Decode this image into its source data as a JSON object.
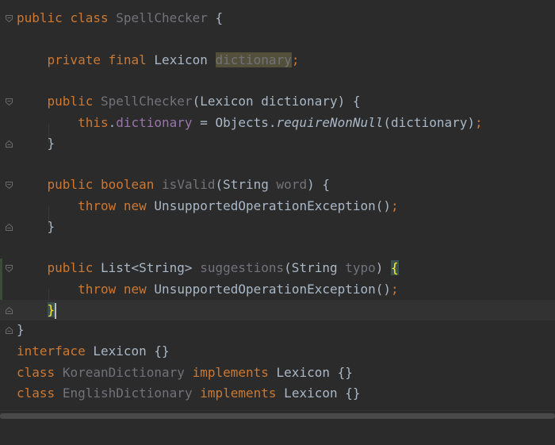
{
  "editor": {
    "lines": {
      "l1": {
        "kw1": "public",
        "kw2": "class",
        "name": "SpellChecker",
        "rest": " {"
      },
      "l3": {
        "kw1": "private",
        "kw2": "final",
        "type": "Lexicon",
        "field": "dictionary",
        "semi": ";"
      },
      "l5": {
        "kw": "public",
        "name": "SpellChecker",
        "rest": "(Lexicon dictionary) {"
      },
      "l6": {
        "kw": "this",
        "dot": ".",
        "field": "dictionary",
        "mid": " = Objects.",
        "method": "requireNonNull",
        "args": "(dictionary)",
        "semi": ";"
      },
      "l7": {
        "text": "}"
      },
      "l9": {
        "kw1": "public",
        "kw2": "boolean",
        "name": "isValid",
        "p1": "(String ",
        "param": "word",
        "p2": ") {"
      },
      "l10": {
        "kw1": "throw",
        "kw2": "new",
        "rest": "UnsupportedOperationException()",
        "semi": ";"
      },
      "l11": {
        "text": "}"
      },
      "l13": {
        "kw": "public",
        "type": "List<String> ",
        "name": "suggestions",
        "p1": "(String ",
        "param": "typo",
        "p2": ") ",
        "brace": "{"
      },
      "l14": {
        "kw1": "throw",
        "kw2": "new",
        "rest": "UnsupportedOperationException()",
        "semi": ";"
      },
      "l15": {
        "text": "}"
      },
      "l16": {
        "text": "}"
      },
      "l17": {
        "kw": "interface",
        "rest": " Lexicon {}"
      },
      "l18": {
        "kw1": "class",
        "name": "KoreanDictionary",
        "kw2": "implements",
        "rest": " Lexicon {}"
      },
      "l19": {
        "kw1": "class",
        "name": "EnglishDictionary",
        "kw2": "implements",
        "rest": " Lexicon {}"
      }
    }
  },
  "colors": {
    "background": "#2b2b2b",
    "keyword": "#cc7832",
    "text": "#a9b7c6",
    "field": "#9876aa",
    "unused": "#72737a"
  }
}
